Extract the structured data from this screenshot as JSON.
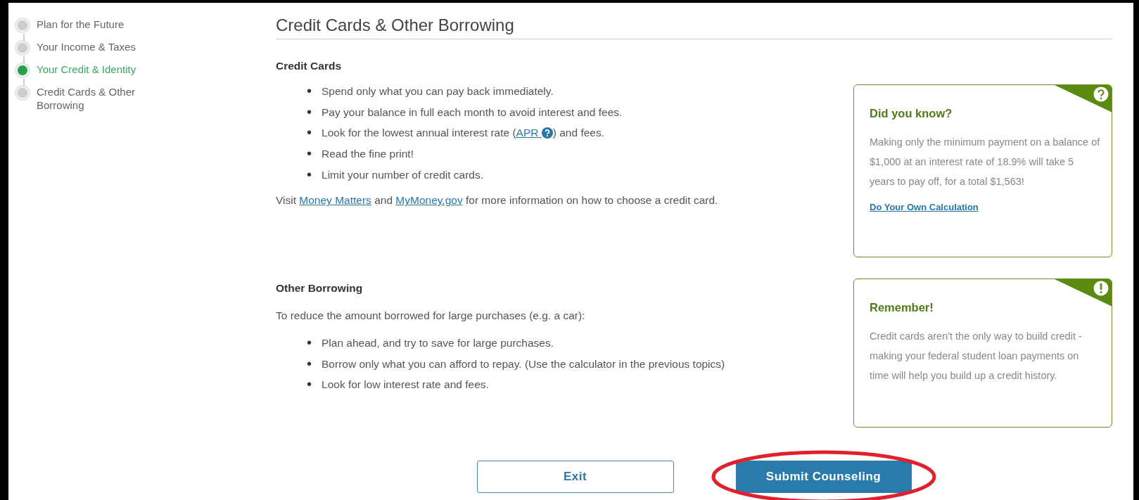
{
  "steps": [
    {
      "label": "Plan for the Future",
      "selected": false
    },
    {
      "label": "Your Income & Taxes",
      "selected": false
    },
    {
      "label": "Your Credit & Identity",
      "selected": true
    },
    {
      "label": "Credit Cards & Other Borrowing",
      "selected": false
    }
  ],
  "page_title": "Credit Cards & Other Borrowing",
  "sections": [
    {
      "heading": "Credit Cards",
      "bullets": [
        {
          "marker": "•",
          "parts": [
            {
              "kind": "text",
              "text": "Spend only what you can pay back immediately."
            }
          ]
        },
        {
          "marker": "•",
          "parts": [
            {
              "kind": "text",
              "text": "Pay your balance in full each month to avoid interest and fees."
            }
          ]
        },
        {
          "marker": "•",
          "parts": [
            {
              "kind": "text",
              "text": "Look for the lowest annual interest rate ("
            },
            {
              "kind": "term",
              "text": "APR"
            },
            {
              "kind": "text",
              "text": ") and fees."
            }
          ]
        },
        {
          "marker": "•",
          "parts": [
            {
              "kind": "text",
              "text": "Read the fine print!"
            }
          ]
        },
        {
          "marker": "•",
          "parts": [
            {
              "kind": "text",
              "text": "Limit your number of credit cards."
            }
          ]
        }
      ],
      "note": [
        {
          "kind": "text",
          "text": "Visit "
        },
        {
          "kind": "link",
          "text": "Money Matters"
        },
        {
          "kind": "text",
          "text": " and "
        },
        {
          "kind": "link",
          "text": "MyMoney.gov"
        },
        {
          "kind": "text",
          "text": " for more information on how to choose a credit card."
        }
      ],
      "tip": {
        "kind": "question",
        "title": "Did you know?",
        "body": "Making only the minimum payment on a balance of $1,000 at an interest rate of 18.9% will take 5 years to pay off, for a total $1,563!",
        "link": "Do Your Own Calculation"
      }
    },
    {
      "heading": "Other Borrowing",
      "intro": "To reduce the amount borrowed for large purchases (e.g. a car):",
      "bullets": [
        {
          "marker": "•",
          "parts": [
            {
              "kind": "text",
              "text": "Plan ahead, and try to save for large purchases."
            }
          ]
        },
        {
          "marker": "•",
          "parts": [
            {
              "kind": "text",
              "text": "Borrow only what you can afford to repay. (Use the calculator in the previous topics)"
            }
          ]
        },
        {
          "marker": "•",
          "parts": [
            {
              "kind": "text",
              "text": "Look for low interest rate and fees."
            }
          ]
        }
      ],
      "tip": {
        "kind": "exclamation",
        "title": "Remember!",
        "body": "Credit cards aren't the only way to build credit - making your federal student loan payments on time will help you build up a credit history."
      }
    }
  ],
  "buttons": [
    {
      "label": "Exit",
      "kind": "secondary",
      "highlighted": false
    },
    {
      "label": "Submit Counseling",
      "kind": "primary",
      "highlighted": true
    }
  ]
}
